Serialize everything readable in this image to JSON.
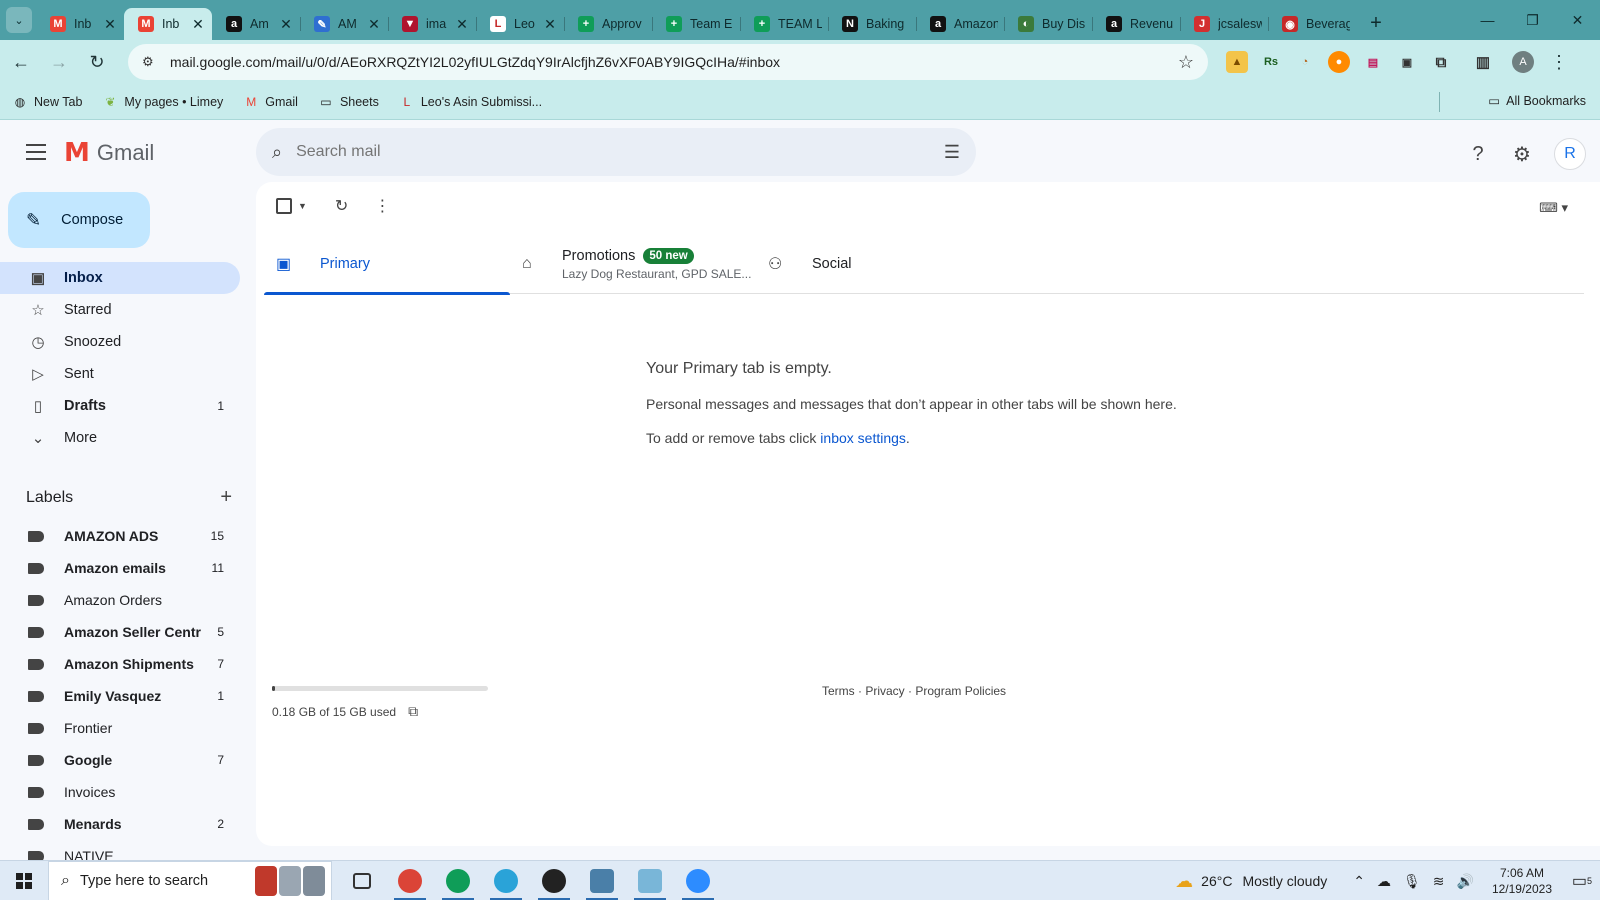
{
  "browser": {
    "tabs": [
      {
        "title": "Inb",
        "favicon": "gmail-icon",
        "color": "#ea4335",
        "glyph": "M",
        "active": false,
        "close": true
      },
      {
        "title": "Inb",
        "favicon": "gmail-icon",
        "color": "#ea4335",
        "glyph": "M",
        "active": true,
        "close": true
      },
      {
        "title": "Am",
        "favicon": "amazon-icon",
        "color": "#111111",
        "glyph": "a",
        "active": false,
        "close": true
      },
      {
        "title": "AM",
        "favicon": "pen-icon",
        "color": "#2f6fd1",
        "glyph": "✎",
        "active": false,
        "close": true
      },
      {
        "title": "ima",
        "favicon": "vercel-icon",
        "color": "#b0142e",
        "glyph": "▼",
        "active": false,
        "close": true
      },
      {
        "title": "Leo",
        "favicon": "leo-icon",
        "color": "#ffffff",
        "glyph": "L",
        "active": false,
        "close": true
      },
      {
        "title": "Approv",
        "favicon": "sheets-icon",
        "color": "#0f9d58",
        "glyph": "+",
        "active": false,
        "close": false
      },
      {
        "title": "Team E",
        "favicon": "sheets-icon",
        "color": "#0f9d58",
        "glyph": "+",
        "active": false,
        "close": false
      },
      {
        "title": "TEAM L",
        "favicon": "sheets-icon",
        "color": "#0f9d58",
        "glyph": "+",
        "active": false,
        "close": false
      },
      {
        "title": "Baking",
        "favicon": "nc-icon",
        "color": "#111111",
        "glyph": "N",
        "active": false,
        "close": false
      },
      {
        "title": "Amazon",
        "favicon": "amazon-icon",
        "color": "#111111",
        "glyph": "a",
        "active": false,
        "close": false
      },
      {
        "title": "Buy Dis",
        "favicon": "site-icon",
        "color": "#3b7a3b",
        "glyph": "◐",
        "active": false,
        "close": false
      },
      {
        "title": "Revenu",
        "favicon": "amazon-icon",
        "color": "#111111",
        "glyph": "a",
        "active": false,
        "close": false
      },
      {
        "title": "jcsalesw",
        "favicon": "jc-icon",
        "color": "#d32f2f",
        "glyph": "J",
        "active": false,
        "close": false
      },
      {
        "title": "Beverag",
        "favicon": "site-icon",
        "color": "#c62828",
        "glyph": "◉",
        "active": false,
        "close": false
      }
    ],
    "url": "mail.google.com/mail/u/0/d/AEoRXRQZtYI2L02yfIULGtZdqY9IrAlcfjhZ6vXF0ABY9IGQcIHa/#inbox",
    "bookmarks": [
      {
        "label": "New Tab",
        "icon": "globe-icon",
        "glyph": "◍"
      },
      {
        "label": "My pages • Limey",
        "icon": "leaf-icon",
        "glyph": "❦"
      },
      {
        "label": "Gmail",
        "icon": "gmail-icon",
        "glyph": "M"
      },
      {
        "label": "Sheets",
        "icon": "folder-icon",
        "glyph": "▭"
      },
      {
        "label": "Leo's Asin Submissi...",
        "icon": "leo-icon",
        "glyph": "L"
      }
    ],
    "all_bookmarks": "All Bookmarks"
  },
  "gmail": {
    "logo_text": "Gmail",
    "search_placeholder": "Search mail",
    "avatar_letter": "R",
    "compose_label": "Compose",
    "nav": [
      {
        "label": "Inbox",
        "icon": "inbox-icon",
        "glyph": "▣",
        "count": "",
        "active": true,
        "bold": true
      },
      {
        "label": "Starred",
        "icon": "star-icon",
        "glyph": "☆",
        "count": "",
        "active": false,
        "bold": false
      },
      {
        "label": "Snoozed",
        "icon": "clock-icon",
        "glyph": "◷",
        "count": "",
        "active": false,
        "bold": false
      },
      {
        "label": "Sent",
        "icon": "send-icon",
        "glyph": "▷",
        "count": "",
        "active": false,
        "bold": false
      },
      {
        "label": "Drafts",
        "icon": "draft-icon",
        "glyph": "▯",
        "count": "1",
        "active": false,
        "bold": true
      },
      {
        "label": "More",
        "icon": "chevron-down-icon",
        "glyph": "⌄",
        "count": "",
        "active": false,
        "bold": false
      }
    ],
    "labels_heading": "Labels",
    "labels": [
      {
        "label": "AMAZON ADS",
        "count": "15",
        "bold": true
      },
      {
        "label": "Amazon emails",
        "count": "11",
        "bold": true
      },
      {
        "label": "Amazon Orders",
        "count": "",
        "bold": false
      },
      {
        "label": "Amazon Seller Centr",
        "count": "5",
        "bold": true
      },
      {
        "label": "Amazon Shipments",
        "count": "7",
        "bold": true
      },
      {
        "label": "Emily Vasquez",
        "count": "1",
        "bold": true
      },
      {
        "label": "Frontier",
        "count": "",
        "bold": false
      },
      {
        "label": "Google",
        "count": "7",
        "bold": true
      },
      {
        "label": "Invoices",
        "count": "",
        "bold": false
      },
      {
        "label": "Menards",
        "count": "2",
        "bold": true
      },
      {
        "label": "NATIVE",
        "count": "",
        "bold": false
      }
    ],
    "inbox_tabs": {
      "primary": "Primary",
      "promotions": "Promotions",
      "promotions_badge": "50 new",
      "promotions_sub": "Lazy Dog Restaurant, GPD SALE...",
      "social": "Social"
    },
    "empty": {
      "heading": "Your Primary tab is empty.",
      "line1": "Personal messages and messages that don’t appear in other tabs will be shown here.",
      "line2_prefix": "To add or remove tabs click ",
      "line2_link": "inbox settings",
      "line2_suffix": "."
    },
    "storage": {
      "text": "0.18 GB of 15 GB used",
      "fraction": 0.012
    },
    "footer": {
      "terms": "Terms",
      "privacy": "Privacy",
      "policies": "Program Policies",
      "sep": " · "
    }
  },
  "taskbar": {
    "search_placeholder": "Type here to search",
    "apps": [
      {
        "name": "task-view-icon",
        "color": "#333333",
        "open": false
      },
      {
        "name": "chrome-icon",
        "color": "#db4437",
        "open": true
      },
      {
        "name": "chrome-profile-icon",
        "color": "#0f9d58",
        "open": true
      },
      {
        "name": "telegram-icon",
        "color": "#2aa3d8",
        "open": true
      },
      {
        "name": "obs-icon",
        "color": "#222222",
        "open": true
      },
      {
        "name": "calculator-icon",
        "color": "#4a7fa8",
        "open": true
      },
      {
        "name": "notes-icon",
        "color": "#79b6d8",
        "open": true
      },
      {
        "name": "zoom-icon",
        "color": "#2d8cff",
        "open": true
      }
    ],
    "temperature": "26°C",
    "weather": "Mostly cloudy",
    "time": "7:06 AM",
    "date": "12/19/2023",
    "notifications": "5"
  }
}
